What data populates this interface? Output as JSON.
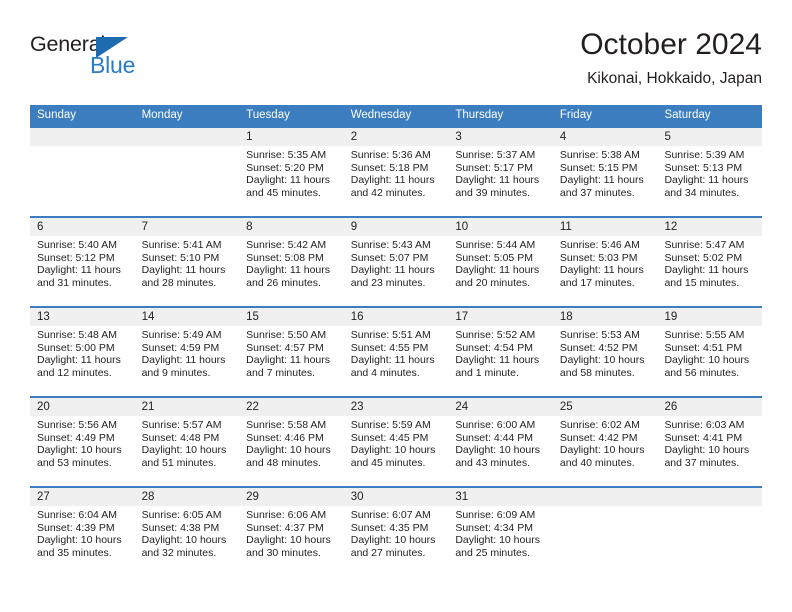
{
  "brand": {
    "name_part1": "General",
    "name_part2": "Blue",
    "triangle_icon": "triangle-icon",
    "colors": {
      "dark": "#231f20",
      "blue": "#2a7cc7",
      "header_blue": "#3b7dbf"
    }
  },
  "header": {
    "title": "October 2024",
    "subtitle": "Kikonai, Hokkaido, Japan"
  },
  "calendar": {
    "weekdays": [
      "Sunday",
      "Monday",
      "Tuesday",
      "Wednesday",
      "Thursday",
      "Friday",
      "Saturday"
    ],
    "weeks": [
      {
        "days": [
          {
            "num": "",
            "sunrise": "",
            "sunset": "",
            "daylight1": "",
            "daylight2": "",
            "empty": true
          },
          {
            "num": "",
            "sunrise": "",
            "sunset": "",
            "daylight1": "",
            "daylight2": "",
            "empty": true
          },
          {
            "num": "1",
            "sunrise": "Sunrise: 5:35 AM",
            "sunset": "Sunset: 5:20 PM",
            "daylight1": "Daylight: 11 hours",
            "daylight2": "and 45 minutes."
          },
          {
            "num": "2",
            "sunrise": "Sunrise: 5:36 AM",
            "sunset": "Sunset: 5:18 PM",
            "daylight1": "Daylight: 11 hours",
            "daylight2": "and 42 minutes."
          },
          {
            "num": "3",
            "sunrise": "Sunrise: 5:37 AM",
            "sunset": "Sunset: 5:17 PM",
            "daylight1": "Daylight: 11 hours",
            "daylight2": "and 39 minutes."
          },
          {
            "num": "4",
            "sunrise": "Sunrise: 5:38 AM",
            "sunset": "Sunset: 5:15 PM",
            "daylight1": "Daylight: 11 hours",
            "daylight2": "and 37 minutes."
          },
          {
            "num": "5",
            "sunrise": "Sunrise: 5:39 AM",
            "sunset": "Sunset: 5:13 PM",
            "daylight1": "Daylight: 11 hours",
            "daylight2": "and 34 minutes."
          }
        ]
      },
      {
        "days": [
          {
            "num": "6",
            "sunrise": "Sunrise: 5:40 AM",
            "sunset": "Sunset: 5:12 PM",
            "daylight1": "Daylight: 11 hours",
            "daylight2": "and 31 minutes."
          },
          {
            "num": "7",
            "sunrise": "Sunrise: 5:41 AM",
            "sunset": "Sunset: 5:10 PM",
            "daylight1": "Daylight: 11 hours",
            "daylight2": "and 28 minutes."
          },
          {
            "num": "8",
            "sunrise": "Sunrise: 5:42 AM",
            "sunset": "Sunset: 5:08 PM",
            "daylight1": "Daylight: 11 hours",
            "daylight2": "and 26 minutes."
          },
          {
            "num": "9",
            "sunrise": "Sunrise: 5:43 AM",
            "sunset": "Sunset: 5:07 PM",
            "daylight1": "Daylight: 11 hours",
            "daylight2": "and 23 minutes."
          },
          {
            "num": "10",
            "sunrise": "Sunrise: 5:44 AM",
            "sunset": "Sunset: 5:05 PM",
            "daylight1": "Daylight: 11 hours",
            "daylight2": "and 20 minutes."
          },
          {
            "num": "11",
            "sunrise": "Sunrise: 5:46 AM",
            "sunset": "Sunset: 5:03 PM",
            "daylight1": "Daylight: 11 hours",
            "daylight2": "and 17 minutes."
          },
          {
            "num": "12",
            "sunrise": "Sunrise: 5:47 AM",
            "sunset": "Sunset: 5:02 PM",
            "daylight1": "Daylight: 11 hours",
            "daylight2": "and 15 minutes."
          }
        ]
      },
      {
        "days": [
          {
            "num": "13",
            "sunrise": "Sunrise: 5:48 AM",
            "sunset": "Sunset: 5:00 PM",
            "daylight1": "Daylight: 11 hours",
            "daylight2": "and 12 minutes."
          },
          {
            "num": "14",
            "sunrise": "Sunrise: 5:49 AM",
            "sunset": "Sunset: 4:59 PM",
            "daylight1": "Daylight: 11 hours",
            "daylight2": "and 9 minutes."
          },
          {
            "num": "15",
            "sunrise": "Sunrise: 5:50 AM",
            "sunset": "Sunset: 4:57 PM",
            "daylight1": "Daylight: 11 hours",
            "daylight2": "and 7 minutes."
          },
          {
            "num": "16",
            "sunrise": "Sunrise: 5:51 AM",
            "sunset": "Sunset: 4:55 PM",
            "daylight1": "Daylight: 11 hours",
            "daylight2": "and 4 minutes."
          },
          {
            "num": "17",
            "sunrise": "Sunrise: 5:52 AM",
            "sunset": "Sunset: 4:54 PM",
            "daylight1": "Daylight: 11 hours",
            "daylight2": "and 1 minute."
          },
          {
            "num": "18",
            "sunrise": "Sunrise: 5:53 AM",
            "sunset": "Sunset: 4:52 PM",
            "daylight1": "Daylight: 10 hours",
            "daylight2": "and 58 minutes."
          },
          {
            "num": "19",
            "sunrise": "Sunrise: 5:55 AM",
            "sunset": "Sunset: 4:51 PM",
            "daylight1": "Daylight: 10 hours",
            "daylight2": "and 56 minutes."
          }
        ]
      },
      {
        "days": [
          {
            "num": "20",
            "sunrise": "Sunrise: 5:56 AM",
            "sunset": "Sunset: 4:49 PM",
            "daylight1": "Daylight: 10 hours",
            "daylight2": "and 53 minutes."
          },
          {
            "num": "21",
            "sunrise": "Sunrise: 5:57 AM",
            "sunset": "Sunset: 4:48 PM",
            "daylight1": "Daylight: 10 hours",
            "daylight2": "and 51 minutes."
          },
          {
            "num": "22",
            "sunrise": "Sunrise: 5:58 AM",
            "sunset": "Sunset: 4:46 PM",
            "daylight1": "Daylight: 10 hours",
            "daylight2": "and 48 minutes."
          },
          {
            "num": "23",
            "sunrise": "Sunrise: 5:59 AM",
            "sunset": "Sunset: 4:45 PM",
            "daylight1": "Daylight: 10 hours",
            "daylight2": "and 45 minutes."
          },
          {
            "num": "24",
            "sunrise": "Sunrise: 6:00 AM",
            "sunset": "Sunset: 4:44 PM",
            "daylight1": "Daylight: 10 hours",
            "daylight2": "and 43 minutes."
          },
          {
            "num": "25",
            "sunrise": "Sunrise: 6:02 AM",
            "sunset": "Sunset: 4:42 PM",
            "daylight1": "Daylight: 10 hours",
            "daylight2": "and 40 minutes."
          },
          {
            "num": "26",
            "sunrise": "Sunrise: 6:03 AM",
            "sunset": "Sunset: 4:41 PM",
            "daylight1": "Daylight: 10 hours",
            "daylight2": "and 37 minutes."
          }
        ]
      },
      {
        "days": [
          {
            "num": "27",
            "sunrise": "Sunrise: 6:04 AM",
            "sunset": "Sunset: 4:39 PM",
            "daylight1": "Daylight: 10 hours",
            "daylight2": "and 35 minutes."
          },
          {
            "num": "28",
            "sunrise": "Sunrise: 6:05 AM",
            "sunset": "Sunset: 4:38 PM",
            "daylight1": "Daylight: 10 hours",
            "daylight2": "and 32 minutes."
          },
          {
            "num": "29",
            "sunrise": "Sunrise: 6:06 AM",
            "sunset": "Sunset: 4:37 PM",
            "daylight1": "Daylight: 10 hours",
            "daylight2": "and 30 minutes."
          },
          {
            "num": "30",
            "sunrise": "Sunrise: 6:07 AM",
            "sunset": "Sunset: 4:35 PM",
            "daylight1": "Daylight: 10 hours",
            "daylight2": "and 27 minutes."
          },
          {
            "num": "31",
            "sunrise": "Sunrise: 6:09 AM",
            "sunset": "Sunset: 4:34 PM",
            "daylight1": "Daylight: 10 hours",
            "daylight2": "and 25 minutes."
          },
          {
            "num": "",
            "sunrise": "",
            "sunset": "",
            "daylight1": "",
            "daylight2": "",
            "empty": true
          },
          {
            "num": "",
            "sunrise": "",
            "sunset": "",
            "daylight1": "",
            "daylight2": "",
            "empty": true
          }
        ]
      }
    ]
  }
}
